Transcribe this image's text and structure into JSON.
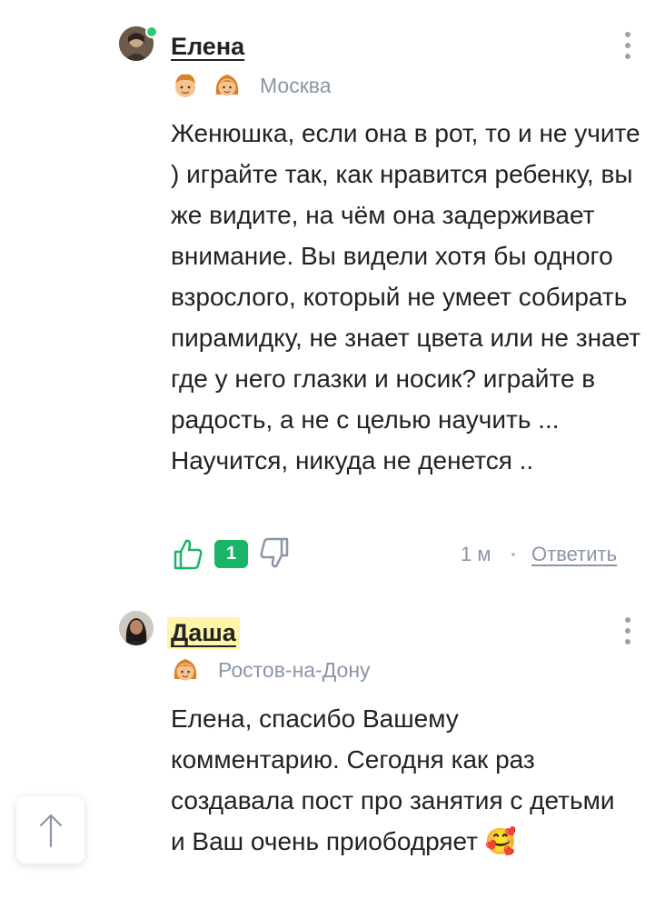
{
  "comments": [
    {
      "author": "Елена",
      "city": "Москва",
      "text": "Женюшка, если она в рот, то и не учите ) играйте так, как нравится ребенку, вы же видите, на чём она задерживает внимание. Вы видели хотя бы одного взрослого, который не умеет собирать пирамидку, не знает цвета или не знает где у него глазки и носик? играйте в радость, а не с целью научить ... Научится, никуда не денется ..",
      "votes": "1",
      "time": "1 м",
      "reply_label": "Ответить",
      "online": true
    },
    {
      "author": "Даша",
      "city": "Ростов-на-Дону",
      "text": "Елена, спасибо Вашему комментарию. Сегодня как раз создавала пост про занятия с детьми и Ваш очень приободряет",
      "emoji": "🥰"
    }
  ],
  "icons": {
    "like": "thumbs-up-icon",
    "dislike": "thumbs-down-icon",
    "menu": "kebab-menu-icon",
    "scroll_top": "arrow-up-icon"
  },
  "colors": {
    "accent_green": "#19b566",
    "muted": "#8a96a6",
    "highlight": "#fdf6a8"
  }
}
